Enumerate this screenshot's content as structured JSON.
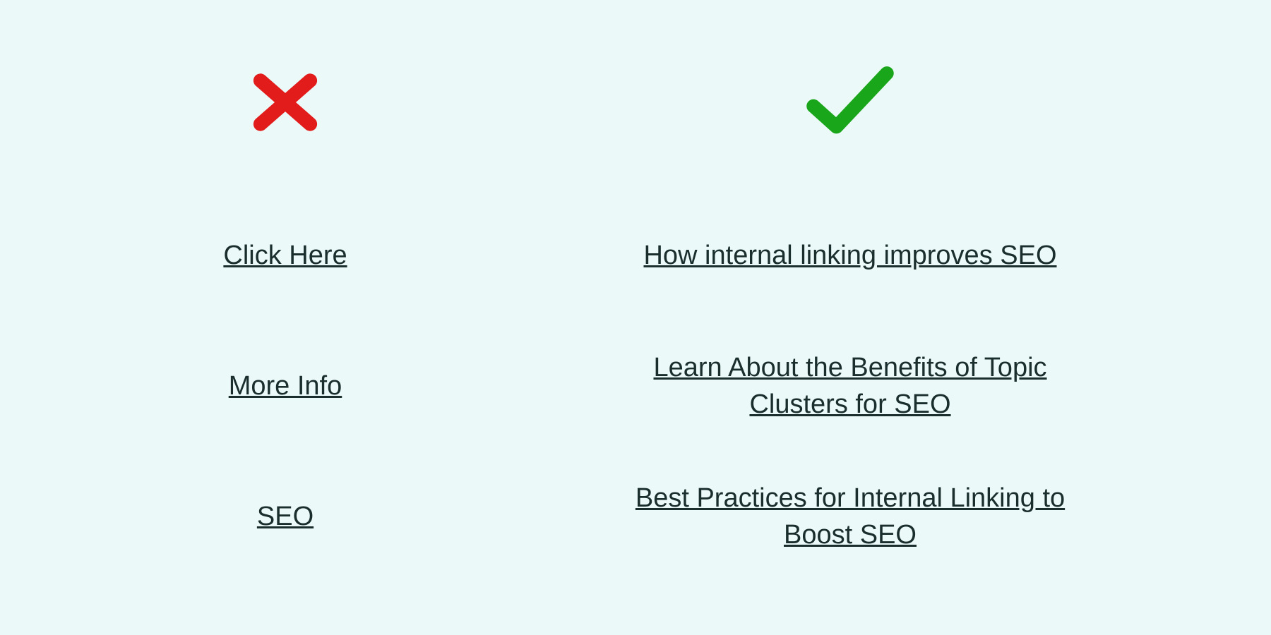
{
  "colors": {
    "background": "#ecf9f9",
    "cross": "#e21b1b",
    "check": "#1aa61a",
    "text": "#1a2e2e"
  },
  "bad": {
    "icon": "cross",
    "links": [
      "Click Here",
      "More Info",
      "SEO"
    ]
  },
  "good": {
    "icon": "check",
    "links": [
      "How internal linking improves SEO",
      "Learn About the Benefits of Topic Clusters for SEO",
      "Best Practices for Internal Linking to Boost SEO"
    ]
  }
}
